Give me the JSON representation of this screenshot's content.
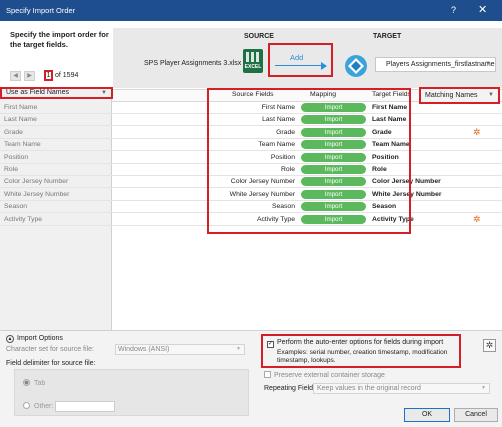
{
  "window": {
    "title": "Specify Import Order",
    "help": "?",
    "close": "✕"
  },
  "header": {
    "prompt": "Specify the import order for the target fields.",
    "record_current": "1",
    "record_total": "of 1594",
    "source_label": "SOURCE",
    "target_label": "TARGET",
    "source_file": "SPS Player Assignments 3.xlsx",
    "excel_icon_text": "EXCEL",
    "add_label": "Add",
    "target_table": "Players Assignments_firstlastname"
  },
  "grid": {
    "field_names_option": "Use as Field Names",
    "col_source": "Source Fields",
    "col_mapping": "Mapping",
    "col_target": "Target Fields",
    "matching_option": "Matching Names",
    "rows": [
      {
        "left": "First Name",
        "source": "First Name",
        "mapping": "Import",
        "target": "First Name",
        "gear": false
      },
      {
        "left": "Last Name",
        "source": "Last Name",
        "mapping": "Import",
        "target": "Last Name",
        "gear": false
      },
      {
        "left": "Grade",
        "source": "Grade",
        "mapping": "Import",
        "target": "Grade",
        "gear": true
      },
      {
        "left": "Team Name",
        "source": "Team Name",
        "mapping": "Import",
        "target": "Team Name",
        "gear": false
      },
      {
        "left": "Position",
        "source": "Position",
        "mapping": "Import",
        "target": "Position",
        "gear": false
      },
      {
        "left": "Role",
        "source": "Role",
        "mapping": "Import",
        "target": "Role",
        "gear": false
      },
      {
        "left": "Color Jersey Number",
        "source": "Color Jersey Number",
        "mapping": "Import",
        "target": "Color Jersey Number",
        "gear": false
      },
      {
        "left": "White Jersey Number",
        "source": "White Jersey Number",
        "mapping": "Import",
        "target": "White Jersey Number",
        "gear": false
      },
      {
        "left": "Season",
        "source": "Season",
        "mapping": "Import",
        "target": "Season",
        "gear": false
      },
      {
        "left": "Activity Type",
        "source": "Activity Type",
        "mapping": "Import",
        "target": "Activity Type",
        "gear": true
      }
    ]
  },
  "options": {
    "toggle_label": "Import Options",
    "charset_label": "Character set for source file:",
    "charset_value": "Windows (ANSI)",
    "delimiter_label": "Field delimiter for source file:",
    "radio_tab": "Tab",
    "radio_other": "Other:",
    "auto_enter_label": "Perform the auto-enter options for fields during import",
    "auto_enter_examples": "Examples: serial number, creation timestamp, modification timestamp, lookups.",
    "preserve_label": "Preserve external container storage",
    "repeating_label": "Repeating Fields:",
    "repeating_value": "Keep values in the original record",
    "ok": "OK",
    "cancel": "Cancel"
  }
}
